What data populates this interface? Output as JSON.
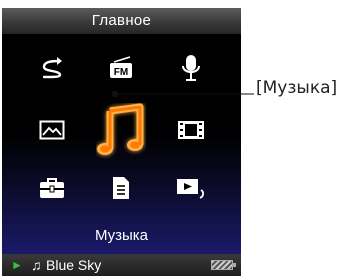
{
  "header": {
    "title": "Главное"
  },
  "menu": {
    "items": [
      {
        "name": "repeat-icon"
      },
      {
        "name": "fm-radio-icon",
        "label": "FM"
      },
      {
        "name": "microphone-icon"
      },
      {
        "name": "photo-icon"
      },
      {
        "name": "music-note-icon",
        "selected": true
      },
      {
        "name": "film-icon"
      },
      {
        "name": "toolbox-icon"
      },
      {
        "name": "document-icon"
      },
      {
        "name": "playlist-icon"
      }
    ],
    "selected_label": "Музыка"
  },
  "status": {
    "play_glyph": "►",
    "note_glyph": "♫",
    "track": "Blue Sky"
  },
  "callout": {
    "text": "[Музыка]"
  },
  "colors": {
    "accent": "#ff8c1a",
    "play": "#38c038",
    "icon": "#ffffff"
  }
}
